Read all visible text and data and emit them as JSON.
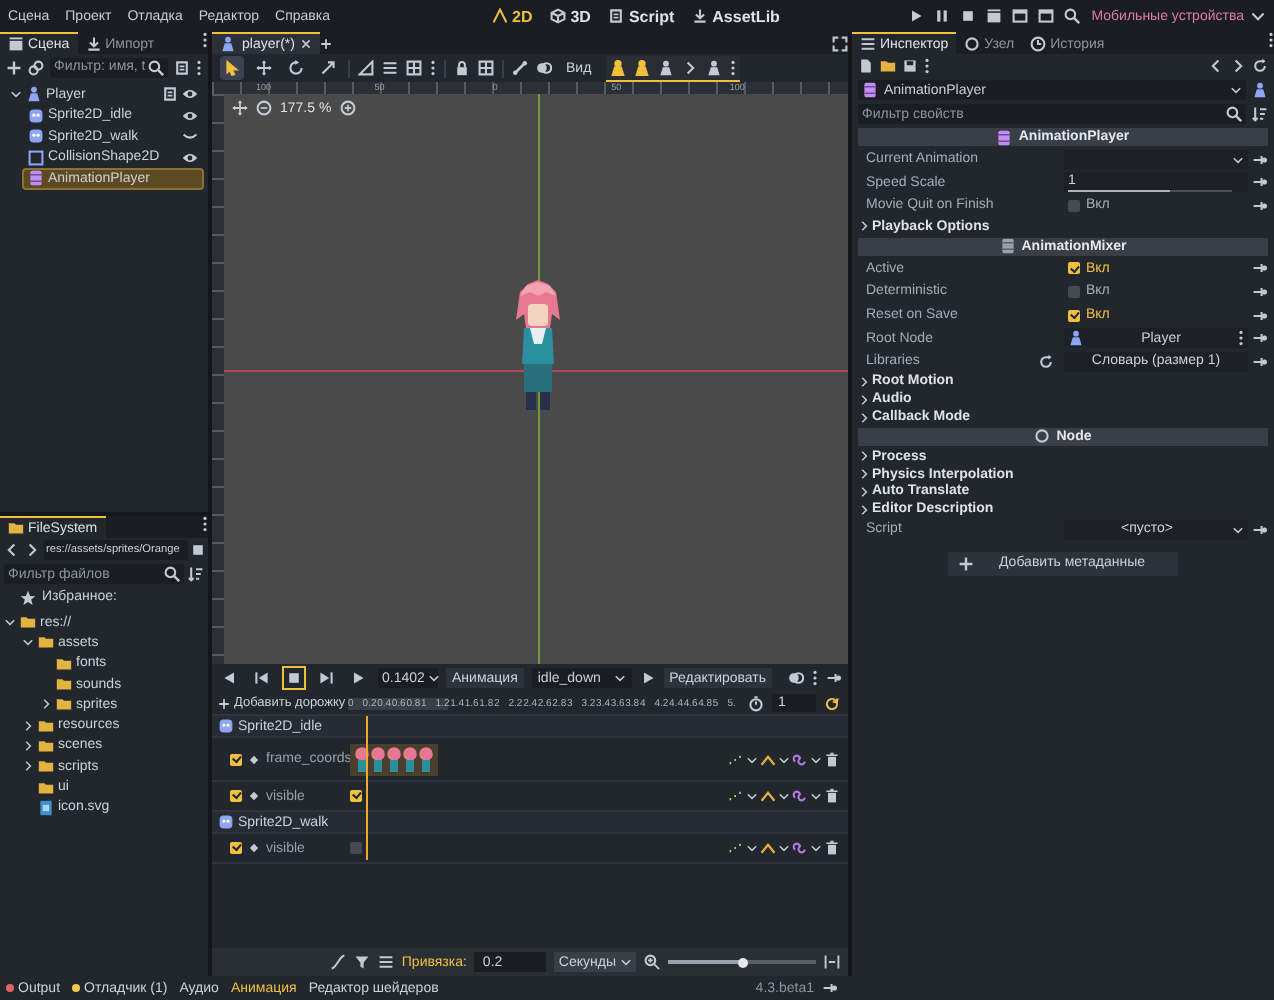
{
  "menu": [
    "Сцена",
    "Проект",
    "Отладка",
    "Редактор",
    "Справка"
  ],
  "workspaces": [
    {
      "label": "2D",
      "selected": true
    },
    {
      "label": "3D",
      "selected": false
    },
    {
      "label": "Script",
      "selected": false
    },
    {
      "label": "AssetLib",
      "selected": false
    }
  ],
  "renderer": "Мобильные устройства",
  "scene_dock": {
    "tabs": [
      {
        "label": "Сцена",
        "selected": true
      },
      {
        "label": "Импорт",
        "selected": false
      }
    ],
    "filter": {
      "placeholder": "Фильтр: имя, t"
    },
    "tree": [
      {
        "label": "Player",
        "kind": "character",
        "visible": true,
        "selected": false,
        "children": [
          {
            "label": "Sprite2D_idle",
            "kind": "sprite",
            "visible": true,
            "selected": false
          },
          {
            "label": "Sprite2D_walk",
            "kind": "sprite",
            "visible": false,
            "selected": false
          },
          {
            "label": "CollisionShape2D",
            "kind": "shape",
            "visible": true,
            "selected": false
          },
          {
            "label": "AnimationPlayer",
            "kind": "animation",
            "selected": true
          }
        ]
      }
    ]
  },
  "filesystem": {
    "tabs": [
      {
        "label": "FileSystem",
        "selected": true
      }
    ],
    "path": "res://assets/sprites/Orange",
    "filter": {
      "placeholder": "Фильтр файлов"
    },
    "favorites": "Избранное:",
    "tree": [
      {
        "label": "res://",
        "kind": "folder",
        "expanded": true,
        "children": [
          {
            "label": "assets",
            "kind": "folder",
            "expanded": true,
            "children": [
              {
                "label": "fonts",
                "kind": "empty_folder"
              },
              {
                "label": "sounds",
                "kind": "empty_folder"
              },
              {
                "label": "sprites",
                "kind": "folder",
                "expanded": false
              }
            ]
          },
          {
            "label": "resources",
            "kind": "folder",
            "expanded": false
          },
          {
            "label": "scenes",
            "kind": "folder",
            "expanded": false
          },
          {
            "label": "scripts",
            "kind": "folder",
            "expanded": false
          },
          {
            "label": "ui",
            "kind": "empty_folder"
          },
          {
            "label": "icon.svg",
            "kind": "file"
          }
        ]
      }
    ]
  },
  "editor_tabs": [
    {
      "label": "player(*)",
      "selected": true
    }
  ],
  "viewport": {
    "tools": [
      {
        "selected": true
      },
      {
        "selected": false
      },
      {
        "selected": false
      },
      {
        "selected": false
      }
    ],
    "view_button": "Вид",
    "overlays": [
      {
        "on": true
      },
      {
        "on": true
      },
      {
        "on": false
      },
      {
        "on": false
      },
      {
        "on": false
      }
    ],
    "ruler": [
      "100",
      "50",
      "0",
      "50",
      "100"
    ],
    "zoom": "177.5 %"
  },
  "animation": {
    "playback_controls": [
      {
        "selected": false
      },
      {
        "selected": false
      },
      {
        "selected": true
      },
      {
        "selected": false
      },
      {
        "selected": false
      }
    ],
    "time": "0.1402",
    "animation_button": "Анимация",
    "animation": "idle_down",
    "edit_button": "Редактировать",
    "add_track": "Добавить дорожку",
    "ticks": [
      "0",
      "0.2",
      "0.4",
      "0.6",
      "0.8",
      "1",
      "1.2",
      "1.4",
      "1.6",
      "1.8",
      "2",
      "2.2",
      "2.4",
      "2.6",
      "2.8",
      "3",
      "3.2",
      "3.4",
      "3.6",
      "3.8",
      "4",
      "4.2",
      "4.4",
      "4.6",
      "4.8",
      "5",
      "5."
    ],
    "length": "1",
    "loop": true,
    "tracks": [
      {
        "kind": "node",
        "label": "Sprite2D_idle"
      },
      {
        "kind": "frames",
        "label": "frame_coords",
        "enabled": true
      },
      {
        "kind": "bool",
        "label": "visible",
        "enabled": true,
        "value": true
      },
      {
        "kind": "node",
        "label": "Sprite2D_walk"
      },
      {
        "kind": "bool",
        "label": "visible",
        "enabled": true,
        "value": false
      }
    ],
    "snap_label": "Привязка:",
    "snap": "0.2",
    "snap_unit": "Секунды",
    "zoom_slider": {
      "level": 0.5
    }
  },
  "inspector": {
    "tabs": [
      {
        "label": "Инспектор",
        "selected": true
      },
      {
        "label": "Узел",
        "selected": false
      },
      {
        "label": "История",
        "selected": false
      }
    ],
    "object": "AnimationPlayer",
    "filter": {
      "placeholder": "Фильтр свойств"
    },
    "rows": [
      {
        "kind": "header",
        "label": "AnimationPlayer"
      },
      {
        "kind": "dropdown",
        "label": "Current Animation"
      },
      {
        "kind": "slider",
        "label": "Speed Scale",
        "value": "1",
        "level": 0.62
      },
      {
        "kind": "check",
        "label": "Movie Quit on Finish",
        "checked": false,
        "value": "Вкл"
      },
      {
        "kind": "group",
        "label": "Playback Options"
      },
      {
        "kind": "header",
        "label": "AnimationMixer"
      },
      {
        "kind": "check",
        "label": "Active",
        "checked": true,
        "value": "Вкл"
      },
      {
        "kind": "check",
        "label": "Deterministic",
        "checked": false,
        "value": "Вкл"
      },
      {
        "kind": "check",
        "label": "Reset on Save",
        "checked": true,
        "value": "Вкл"
      },
      {
        "kind": "node",
        "label": "Root Node",
        "value": "Player"
      },
      {
        "kind": "resource",
        "label": "Libraries",
        "value": "Словарь (размер 1)"
      },
      {
        "kind": "group",
        "label": "Root Motion"
      },
      {
        "kind": "group",
        "label": "Audio"
      },
      {
        "kind": "group",
        "label": "Callback Mode"
      },
      {
        "kind": "header",
        "label": "Node"
      },
      {
        "kind": "group",
        "label": "Process"
      },
      {
        "kind": "group",
        "label": "Physics Interpolation"
      },
      {
        "kind": "group",
        "label": "Auto Translate"
      },
      {
        "kind": "group",
        "label": "Editor Description"
      },
      {
        "kind": "dropdown",
        "label": "Script",
        "value": "<пусто>"
      }
    ],
    "add_metadata": "Добавить метаданные"
  },
  "bottom_panel": {
    "tabs": [
      {
        "label": "Output",
        "selected": false,
        "color": "#e06666"
      },
      {
        "label": "Отладчик (1)",
        "selected": false,
        "color": "#f0c850"
      },
      {
        "label": "Аудио",
        "selected": false
      },
      {
        "label": "Анимация",
        "selected": true
      },
      {
        "label": "Редактор шейдеров",
        "selected": false
      }
    ],
    "version": "4.3.beta1"
  }
}
